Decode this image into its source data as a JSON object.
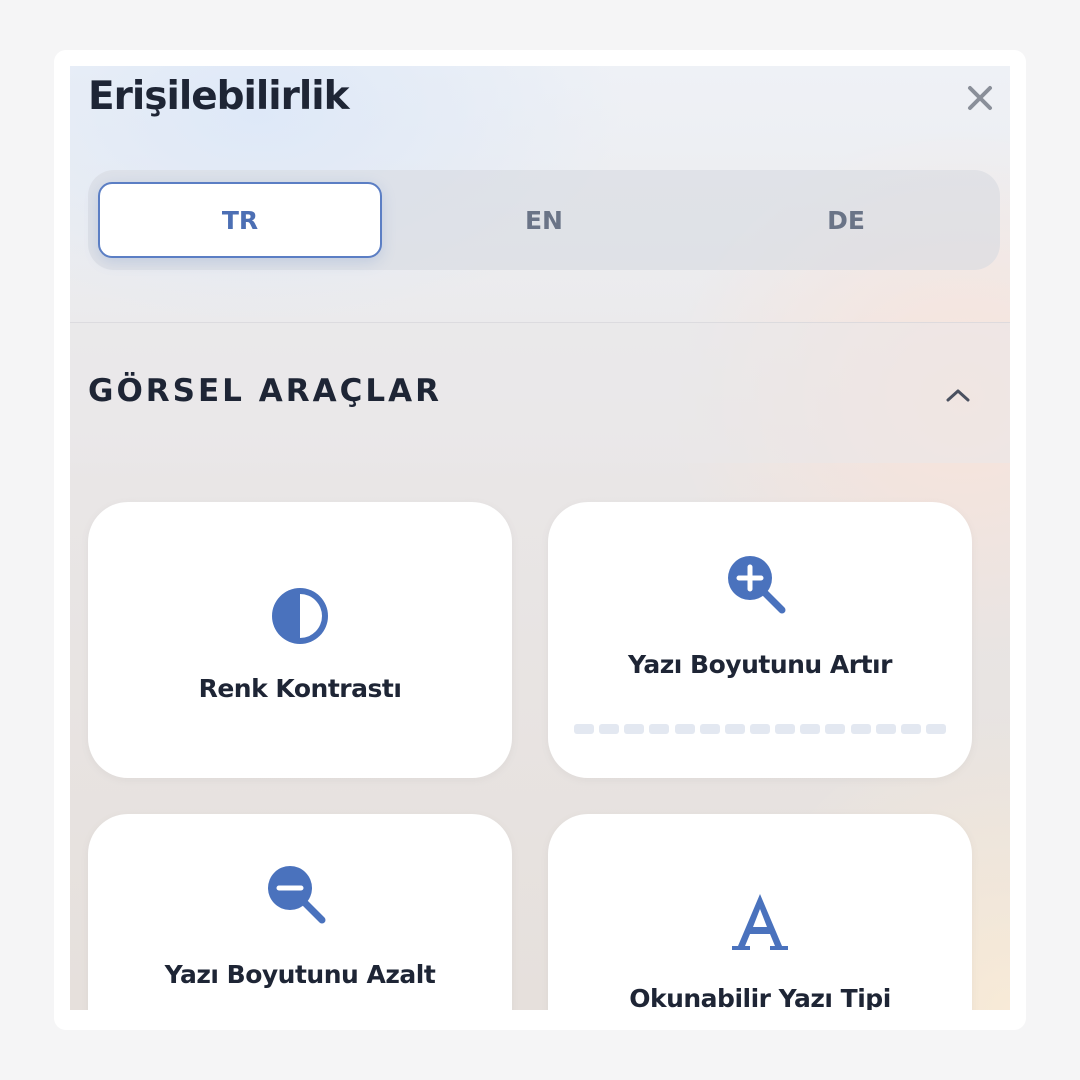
{
  "panel": {
    "title": "Erişilebilirlik",
    "close_icon": "close-icon"
  },
  "languages": {
    "selected": "TR",
    "tabs": [
      {
        "label": "TR",
        "active": true
      },
      {
        "label": "EN",
        "active": false
      },
      {
        "label": "DE",
        "active": false
      }
    ]
  },
  "section": {
    "title": "GÖRSEL ARAÇLAR",
    "expanded": true,
    "toggle_icon": "chevron-up-icon"
  },
  "tools": [
    {
      "label": "Renk Kontrastı",
      "icon": "contrast-icon"
    },
    {
      "label": "Yazı Boyutunu Artır",
      "icon": "zoom-in-icon",
      "level": 0,
      "level_steps": 15
    },
    {
      "label": "Yazı Boyutunu Azalt",
      "icon": "zoom-out-icon"
    },
    {
      "label": "Okunabilir Yazı Tipi",
      "icon": "letter-a-icon"
    }
  ],
  "colors": {
    "accent": "#4c6fb4",
    "icon": "#4a72bd",
    "text": "#1e2535",
    "muted": "#6a7487"
  }
}
